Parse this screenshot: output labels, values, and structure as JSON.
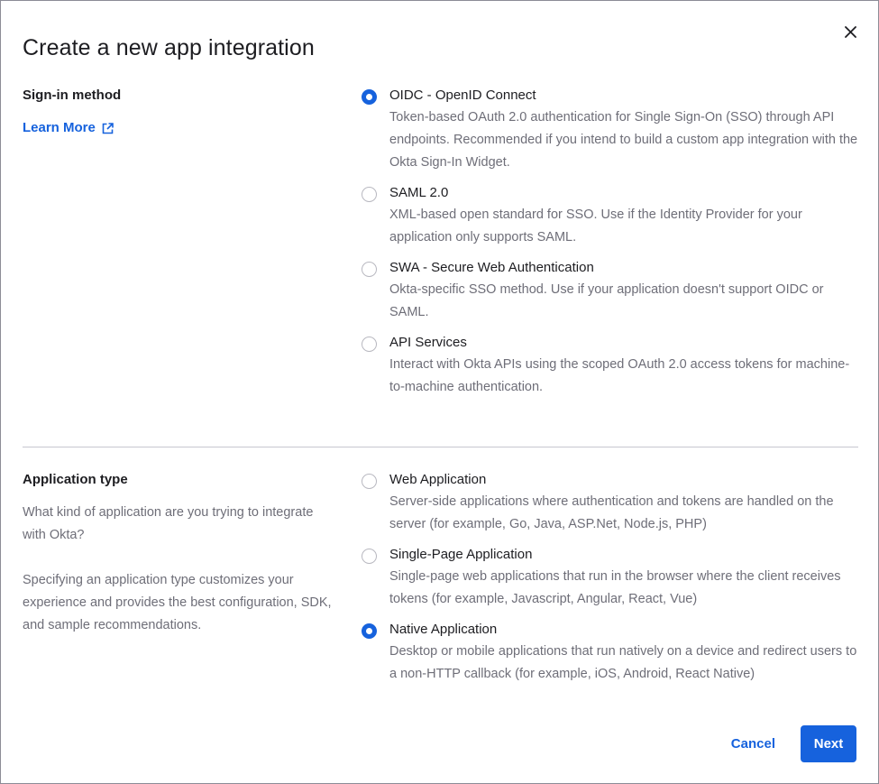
{
  "dialog": {
    "title": "Create a new app integration",
    "close_icon": "close-icon"
  },
  "signin": {
    "label": "Sign-in method",
    "learn_more": "Learn More",
    "learn_more_icon": "external-link-icon",
    "options": [
      {
        "label": "OIDC - OpenID Connect",
        "description": "Token-based OAuth 2.0 authentication for Single Sign-On (SSO) through API endpoints. Recommended if you intend to build a custom app integration with the Okta Sign-In Widget.",
        "checked": true
      },
      {
        "label": "SAML 2.0",
        "description": "XML-based open standard for SSO. Use if the Identity Provider for your application only supports SAML.",
        "checked": false
      },
      {
        "label": "SWA - Secure Web Authentication",
        "description": "Okta-specific SSO method. Use if your application doesn't support OIDC or SAML.",
        "checked": false
      },
      {
        "label": "API Services",
        "description": "Interact with Okta APIs using the scoped OAuth 2.0 access tokens for machine-to-machine authentication.",
        "checked": false
      }
    ]
  },
  "apptype": {
    "label": "Application type",
    "description_1": "What kind of application are you trying to integrate with Okta?",
    "description_2": "Specifying an application type customizes your experience and provides the best configuration, SDK, and sample recommendations.",
    "options": [
      {
        "label": "Web Application",
        "description": "Server-side applications where authentication and tokens are handled on the server (for example, Go, Java, ASP.Net, Node.js, PHP)",
        "checked": false
      },
      {
        "label": "Single-Page Application",
        "description": "Single-page web applications that run in the browser where the client receives tokens (for example, Javascript, Angular, React, Vue)",
        "checked": false
      },
      {
        "label": "Native Application",
        "description": "Desktop or mobile applications that run natively on a device and redirect users to a non-HTTP callback (for example, iOS, Android, React Native)",
        "checked": true
      }
    ]
  },
  "footer": {
    "cancel_label": "Cancel",
    "next_label": "Next"
  },
  "colors": {
    "accent": "#1662dd",
    "text": "#1d1d21",
    "muted": "#6e6e78"
  }
}
